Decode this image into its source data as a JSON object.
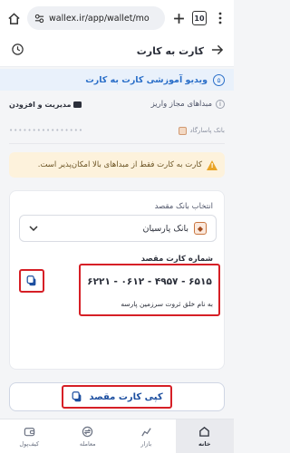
{
  "browser": {
    "url": "wallex.ir/app/wallet/mo",
    "tabs_count": "10",
    "icons": [
      "home-icon",
      "site-settings-icon",
      "plus-icon",
      "tabs-icon",
      "kebab-menu-icon"
    ]
  },
  "header": {
    "title": "کارت به کارت",
    "icons": [
      "history-icon",
      "back-arrow-icon"
    ]
  },
  "video_tutorial": {
    "label": "ویدیو آموزشی کارت به کارت",
    "number": "۵"
  },
  "origins": {
    "title": "مبداهای مجاز واریز",
    "manage_label": "مدیریت و افزودن",
    "bank_label": "بانک پاسارگاد",
    "masked_number": "••••••••••••••••"
  },
  "warning": {
    "text": "کارت به کارت فقط از مبداهای بالا امکان‌پذیر است."
  },
  "destination": {
    "select_label": "انتخاب بانک مقصد",
    "bank_name": "بانک پارسیان",
    "card_label": "شماره کارت مقصد",
    "card_number": "۶۲۲۱ - ۰۶۱۲ - ۴۹۵۷ - ۶۵۱۵",
    "owner": "به نام خلق ثروت سرزمین پارسه"
  },
  "copy_button": {
    "label": "کپی کارت مقصد"
  },
  "bottom_nav": [
    {
      "label": "خانه",
      "icon": "home-icon",
      "active": true
    },
    {
      "label": "بازار",
      "icon": "market-icon",
      "active": false
    },
    {
      "label": "معامله",
      "icon": "trade-icon",
      "active": false
    },
    {
      "label": "کیف‌پول",
      "icon": "wallet-icon",
      "active": false
    }
  ],
  "colors": {
    "accent": "#2a6fc9",
    "highlight_red": "#d61f26",
    "warning_bg": "#fdf2dc"
  }
}
